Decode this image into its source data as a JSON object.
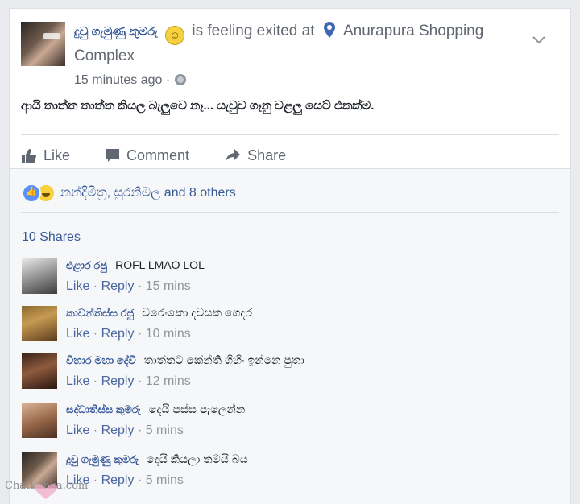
{
  "post": {
    "author": "දුවු ගැමුණු කුමරු",
    "feeling_text": "is feeling exited at",
    "place": "Anurapura Shopping Complex",
    "timestamp": "15 minutes ago ·",
    "body": "ආයි තාත්ත තාත්ත කියල බැලුවෙ නෑ... යැවුව ගෑනු වළලු සෙට් එකක්ම."
  },
  "actions": {
    "like": "Like",
    "comment": "Comment",
    "share": "Share"
  },
  "reactions": {
    "text": "නන්දිමිත්‍ර, සුරනිමල and 8 others"
  },
  "shares": {
    "text": "10 Shares"
  },
  "comments": [
    {
      "name": "එළාර රජු",
      "text": "ROFL LMAO LOL",
      "like": "Like",
      "reply": "Reply",
      "time": "· 15 mins"
    },
    {
      "name": "කාවන්තිස්ස රජු",
      "text": "වරෙංකො දවසක ගෙදර",
      "like": "Like",
      "reply": "Reply",
      "time": "· 10 mins"
    },
    {
      "name": "විහාර මහා දේවි",
      "text": "තාත්තට කේන්ති ගිහිං ඉන්නෙ පුතා",
      "like": "Like",
      "reply": "Reply",
      "time": "· 12 mins"
    },
    {
      "name": "සද්ධාතිස්ස කුමරු",
      "text": "දෙයි පස්ස පැලෙන්න",
      "like": "Like",
      "reply": "Reply",
      "time": "· 5 mins"
    },
    {
      "name": "දුවු ගැමුණු කුමරු",
      "text": "දෙයි කියලා තමයි බය",
      "like": "Like",
      "reply": "Reply",
      "time": "· 5 mins"
    }
  ],
  "watermark": "ChatLanka.com",
  "colors": {
    "link": "#385898",
    "muted": "#90949c",
    "place_pin": "#4267b2"
  }
}
